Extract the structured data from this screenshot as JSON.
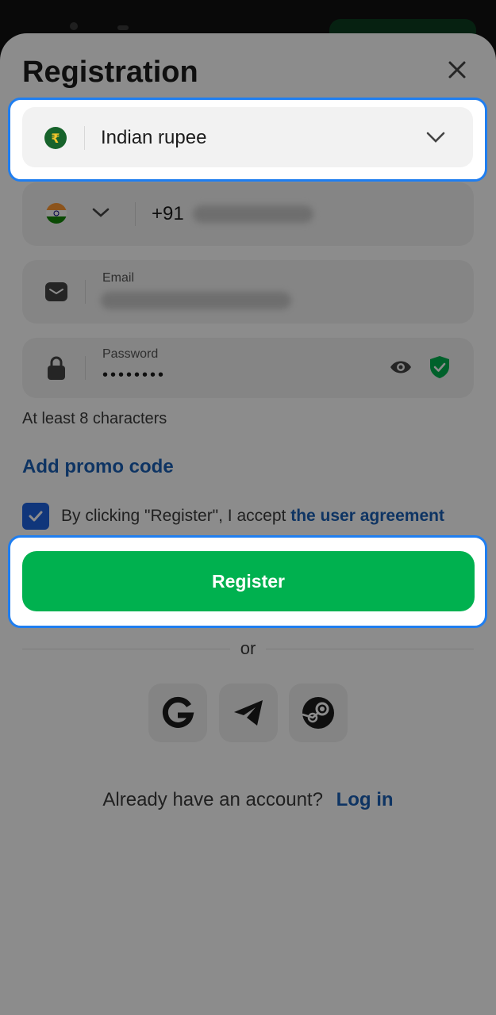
{
  "modal": {
    "title": "Registration"
  },
  "currency": {
    "value": "Indian rupee",
    "icon": "rupee-coin-icon",
    "symbol": "₹"
  },
  "phone": {
    "country_code": "+91",
    "flag": "india-flag-icon"
  },
  "email": {
    "label": "Email"
  },
  "password": {
    "label": "Password",
    "masked_value": "••••••••",
    "hint": "At least 8 characters"
  },
  "promo": {
    "label": "Add promo code"
  },
  "agreement": {
    "text": "By clicking \"Register\", I accept",
    "link": "the user agreement",
    "checked": true
  },
  "register": {
    "label": "Register"
  },
  "divider": {
    "or": "or"
  },
  "social": [
    "google-icon",
    "telegram-icon",
    "steam-icon"
  ],
  "footer": {
    "question": "Already have an account?",
    "login": "Log in"
  },
  "colors": {
    "accent_green": "#00b14f",
    "link_blue": "#1a5fb4",
    "highlight_border": "#1f7ef0"
  }
}
